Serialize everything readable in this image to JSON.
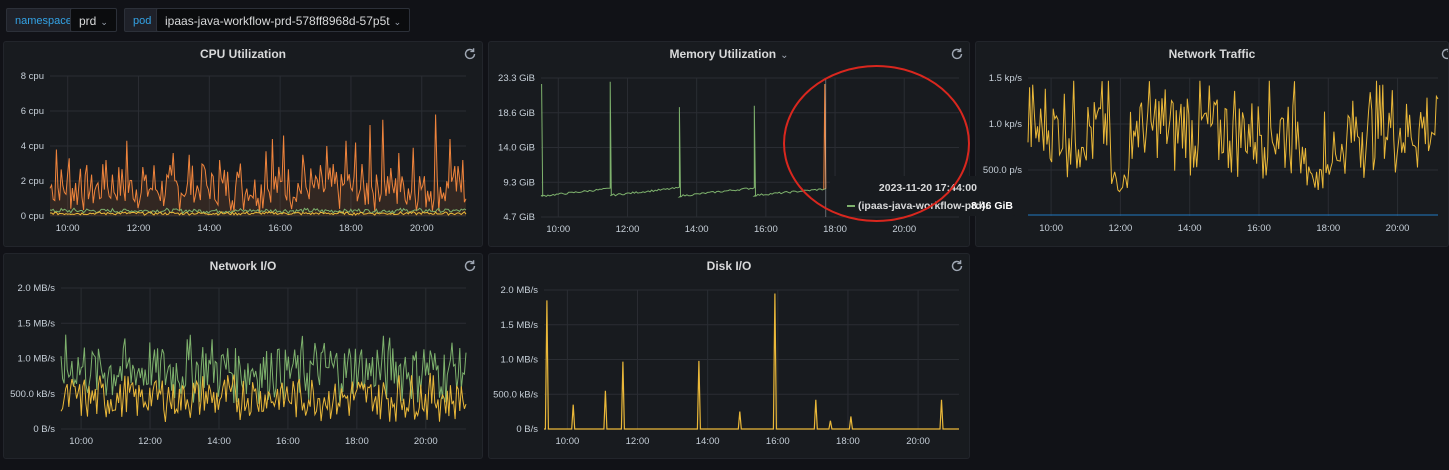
{
  "variables": [
    {
      "label": "namespace",
      "value": "prd"
    },
    {
      "label": "pod",
      "value": "ipaas-java-workflow-prd-578ff8968d-57p5t"
    }
  ],
  "colors": {
    "green": "#7eb26d",
    "yellow": "#eab839",
    "orange": "#ef843c",
    "blue": "#1f78c1",
    "highlight": "#d9271e"
  },
  "panels": {
    "cpu": {
      "title": "CPU Utilization"
    },
    "memory": {
      "title": "Memory Utilization"
    },
    "network_traffic": {
      "title": "Network Traffic"
    },
    "network_io": {
      "title": "Network I/O"
    },
    "disk_io": {
      "title": "Disk I/O"
    }
  },
  "tooltip": {
    "time": "2023-11-20 17:44:00",
    "series": "(ipaas-java-workflow-prd):",
    "value": "8.46 GiB"
  },
  "chart_data": [
    {
      "id": "cpu",
      "type": "line",
      "title": "CPU Utilization",
      "x": [
        "10:00",
        "12:00",
        "14:00",
        "16:00",
        "18:00",
        "20:00"
      ],
      "y_ticks": [
        "0 cpu",
        "2 cpu",
        "4 cpu",
        "6 cpu",
        "8 cpu"
      ],
      "ylim": [
        0,
        8
      ],
      "series": [
        {
          "color": "#ef843c",
          "baseline": 1.6,
          "noise": 1.4,
          "spikes": [
            [
              2,
              3.8
            ],
            [
              6,
              3.3
            ],
            [
              10,
              2.7
            ],
            [
              18,
              3.2
            ],
            [
              25,
              4.3
            ],
            [
              30,
              2.8
            ],
            [
              34,
              2.9
            ],
            [
              40,
              3.6
            ],
            [
              45,
              3.5
            ],
            [
              50,
              2.9
            ],
            [
              55,
              3.2
            ],
            [
              62,
              3.0
            ],
            [
              70,
              3.7
            ],
            [
              72,
              4.4
            ],
            [
              76,
              4.6
            ],
            [
              82,
              3.5
            ],
            [
              90,
              4.0
            ],
            [
              96,
              4.3
            ],
            [
              99,
              4.2
            ],
            [
              104,
              5.2
            ],
            [
              108,
              5.5
            ],
            [
              113,
              3.6
            ],
            [
              118,
              3.9
            ],
            [
              125,
              5.8
            ],
            [
              130,
              4.4
            ],
            [
              134,
              3.2
            ]
          ]
        },
        {
          "color": "#7eb26d",
          "baseline": 0.3,
          "noise": 0.15,
          "spikes": []
        },
        {
          "color": "#eab839",
          "baseline": 0.15,
          "noise": 0.1,
          "spikes": []
        }
      ]
    },
    {
      "id": "memory",
      "type": "line",
      "title": "Memory Utilization",
      "x": [
        "10:00",
        "12:00",
        "14:00",
        "16:00",
        "18:00",
        "20:00"
      ],
      "y_ticks": [
        "4.7 GiB",
        "9.3 GiB",
        "14.0 GiB",
        "18.6 GiB",
        "23.3 GiB"
      ],
      "ylim": [
        4.7,
        23.3
      ],
      "series": [
        {
          "color": "#7eb26d",
          "segments": [
            {
              "x": [
                "09:30",
                "11:30"
              ],
              "y": [
                7.5,
                8.5
              ],
              "peak": 22.5
            },
            {
              "x": [
                "11:30",
                "13:30"
              ],
              "y": [
                7.6,
                8.6
              ],
              "peak": 22.8
            },
            {
              "x": [
                "13:30",
                "15:40"
              ],
              "y": [
                7.5,
                8.6
              ],
              "peak": 19.4
            },
            {
              "x": [
                "15:40",
                "17:44"
              ],
              "y": [
                7.6,
                8.46
              ],
              "peak": 19.6
            }
          ]
        },
        {
          "color": "#ef843c",
          "spike_at": "17:44",
          "peak": 22.5
        }
      ]
    },
    {
      "id": "network_traffic",
      "type": "line",
      "title": "Network Traffic",
      "x": [
        "10:00",
        "12:00",
        "14:00",
        "16:00",
        "18:00",
        "20:00"
      ],
      "y_ticks": [
        "500.0 p/s",
        "1.0 kp/s",
        "1.5 kp/s"
      ],
      "ylim": [
        0,
        1.5
      ],
      "series": [
        {
          "color": "#eab839",
          "baseline": 0.95,
          "noise": 0.55
        },
        {
          "color": "#1f78c1",
          "constant": 0
        }
      ]
    },
    {
      "id": "network_io",
      "type": "line",
      "title": "Network I/O",
      "x": [
        "10:00",
        "12:00",
        "14:00",
        "16:00",
        "18:00",
        "20:00"
      ],
      "y_ticks": [
        "0 B/s",
        "500.0 kB/s",
        "1.0 MB/s",
        "1.5 MB/s",
        "2.0 MB/s"
      ],
      "ylim": [
        0,
        2.0
      ],
      "series": [
        {
          "color": "#7eb26d",
          "baseline": 0.85,
          "noise": 0.5
        },
        {
          "color": "#eab839",
          "baseline": 0.45,
          "noise": 0.35
        }
      ]
    },
    {
      "id": "disk_io",
      "type": "line",
      "title": "Disk I/O",
      "x": [
        "10:00",
        "12:00",
        "14:00",
        "16:00",
        "18:00",
        "20:00"
      ],
      "y_ticks": [
        "0 B/s",
        "500.0 kB/s",
        "1.0 MB/s",
        "1.5 MB/s",
        "2.0 MB/s"
      ],
      "ylim": [
        0,
        2.0
      ],
      "series": [
        {
          "color": "#eab839",
          "spikes": [
            [
              "09:25",
              1.85
            ],
            [
              "10:10",
              0.35
            ],
            [
              "11:05",
              0.55
            ],
            [
              "11:35",
              0.97
            ],
            [
              "13:45",
              0.98
            ],
            [
              "14:55",
              0.25
            ],
            [
              "15:55",
              1.95
            ],
            [
              "17:05",
              0.42
            ],
            [
              "17:30",
              0.12
            ],
            [
              "18:05",
              0.18
            ],
            [
              "20:40",
              0.42
            ]
          ]
        }
      ]
    }
  ]
}
